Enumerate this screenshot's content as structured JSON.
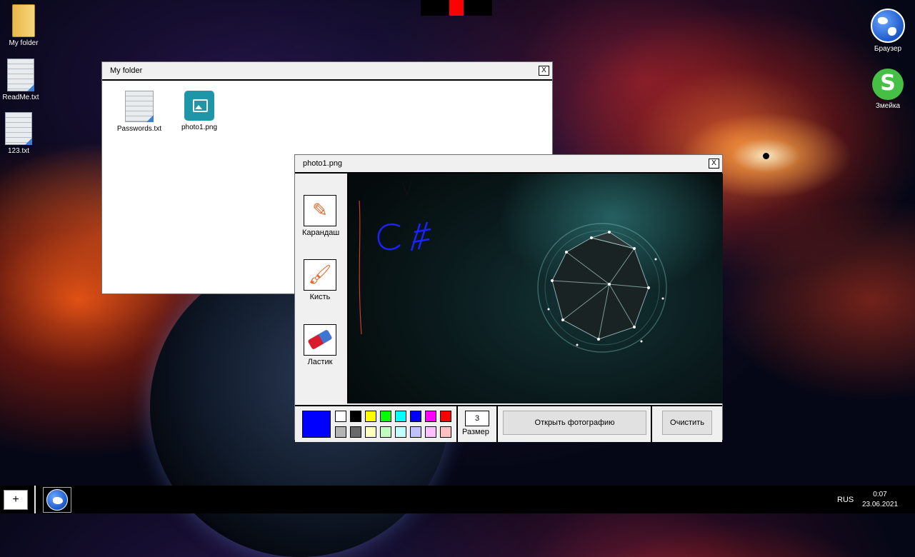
{
  "desktop": {
    "icons_left": [
      {
        "label": "My folder",
        "type": "folder"
      },
      {
        "label": "ReadMe.txt",
        "type": "text"
      },
      {
        "label": "123.txt",
        "type": "text"
      }
    ],
    "icons_right": [
      {
        "label": "Браузер",
        "icon": "globe-icon"
      },
      {
        "label": "Змейка",
        "icon": "snake-icon"
      }
    ]
  },
  "folder_window": {
    "title": "My folder",
    "close_label": "X",
    "files": [
      {
        "label": "Passwords.txt",
        "type": "text"
      },
      {
        "label": "photo1.png",
        "type": "image"
      }
    ]
  },
  "editor_window": {
    "title": "photo1.png",
    "close_label": "X",
    "tools": [
      {
        "label": "Карандаш",
        "icon": "pencil-icon"
      },
      {
        "label": "Кисть",
        "icon": "brush-icon"
      },
      {
        "label": "Ластик",
        "icon": "eraser-icon"
      }
    ],
    "current_color": "#0000ff",
    "palette_row1": [
      "#ffffff",
      "#000000",
      "#ffff00",
      "#00ff00",
      "#00ffff",
      "#0000ff",
      "#ff00ff",
      "#ff0000"
    ],
    "palette_row2": [
      "#b4b4b4",
      "#696969",
      "#ffffc0",
      "#c0ffc0",
      "#c0ffff",
      "#c0c0ff",
      "#ffc0ff",
      "#ffc0c0"
    ],
    "size_value": "3",
    "size_label": "Размер",
    "open_button": "Открыть фотографию",
    "clear_button": "Очистить"
  },
  "taskbar": {
    "add_label": "+",
    "language": "RUS",
    "time": "0:07",
    "date": "23.06.2021"
  }
}
